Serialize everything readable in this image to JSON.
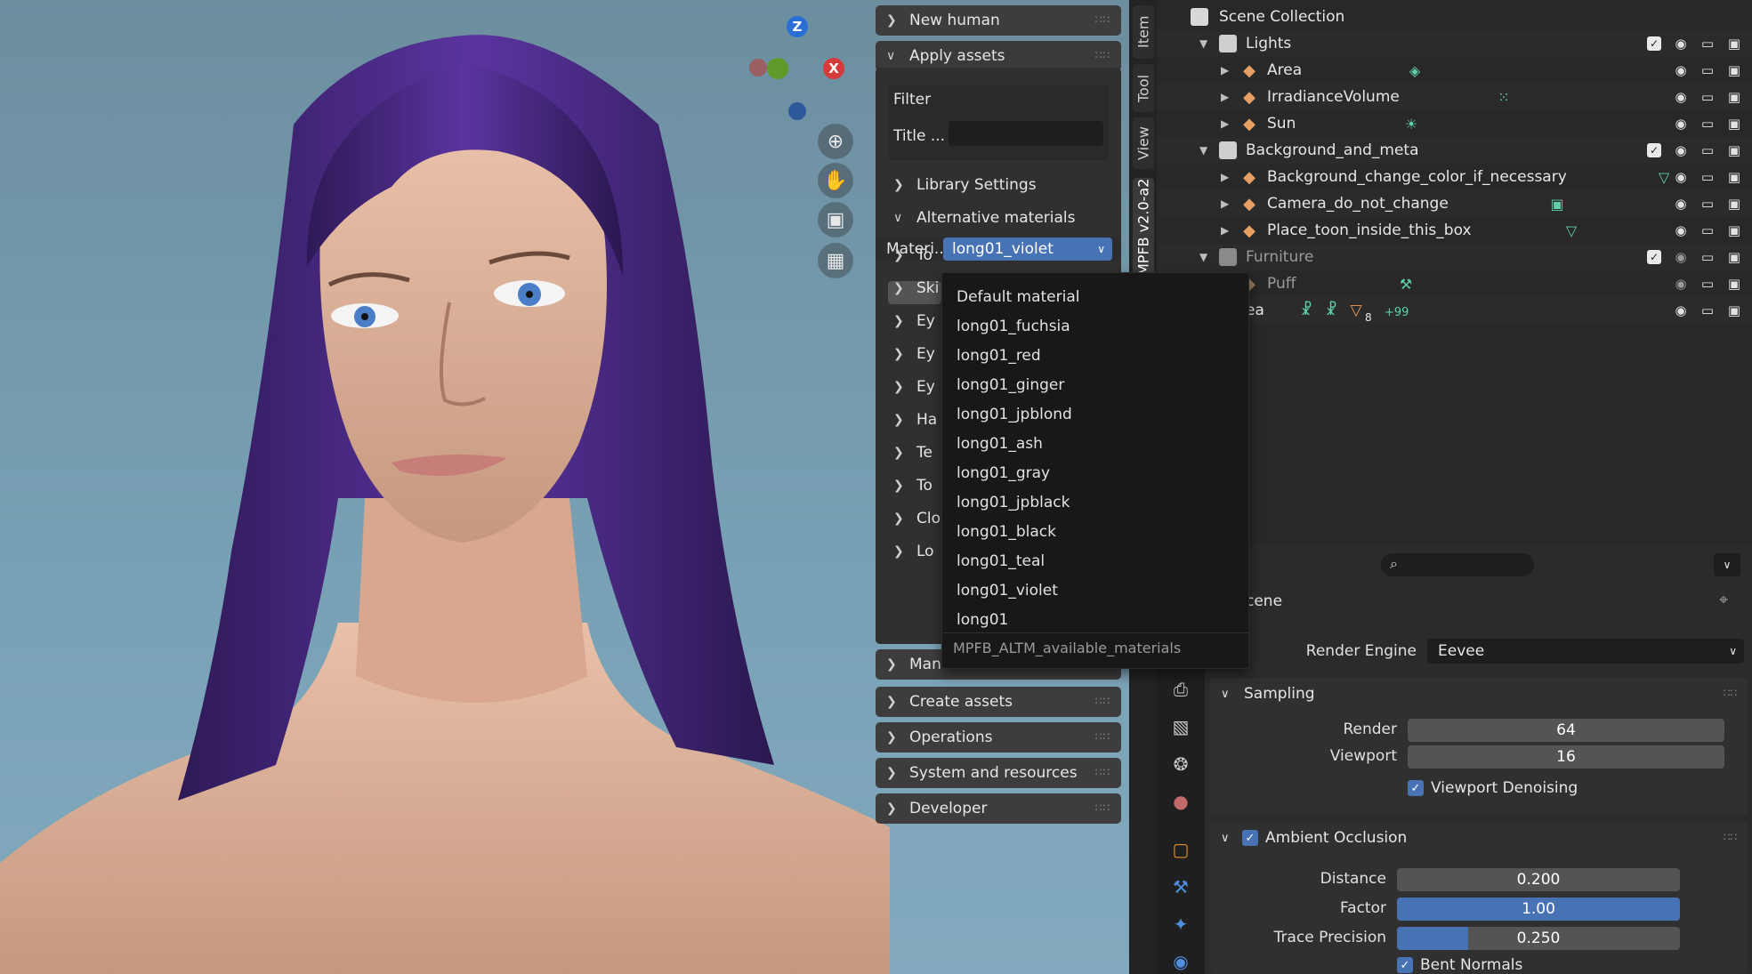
{
  "colors": {
    "accent": "#4772b3",
    "dropdown_bg": "#181818",
    "panel_bg": "#303030",
    "hair": "#4a2a86"
  },
  "viewport": {
    "gizmo": {
      "z": "Z",
      "x": "X",
      "y": "Y"
    },
    "tools": [
      "zoom-icon",
      "hand-icon",
      "camera-icon",
      "grid-icon"
    ]
  },
  "npanel": {
    "new_human": "New human",
    "apply_assets": "Apply assets",
    "filter": "Filter",
    "title_label": "Title ...",
    "title_value": "",
    "library_settings": "Library Settings",
    "alternative_materials": "Alternative materials",
    "material_label": "Materi...",
    "material_value": "long01_violet",
    "sub_items": [
      "To",
      "Ski",
      "Ey",
      "Ey",
      "Ey",
      "Ha",
      "Te",
      "To",
      "Clo",
      "Lo"
    ],
    "manage": "Mana",
    "create_assets": "Create assets",
    "operations": "Operations",
    "system_resources": "System and resources",
    "developer": "Developer"
  },
  "sidebar_tabs": [
    "Item",
    "Tool",
    "View",
    "MPFB v2.0-a2"
  ],
  "dropdown": {
    "items": [
      "Default material",
      "long01_fuchsia",
      "long01_red",
      "long01_ginger",
      "long01_jpblond",
      "long01_ash",
      "long01_gray",
      "long01_jpblack",
      "long01_black",
      "long01_teal",
      "long01_violet",
      "long01"
    ],
    "footer": "MPFB_ALTM_available_materials"
  },
  "outliner": {
    "scene_collection": "Scene Collection",
    "rows": [
      {
        "label": "Lights",
        "kind": "collection"
      },
      {
        "label": "Area",
        "kind": "light"
      },
      {
        "label": "IrradianceVolume",
        "kind": "probe"
      },
      {
        "label": "Sun",
        "kind": "light"
      },
      {
        "label": "Background_and_meta",
        "kind": "collection"
      },
      {
        "label": "Background_change_color_if_necessary",
        "kind": "mesh"
      },
      {
        "label": "Camera_do_not_change",
        "kind": "camera"
      },
      {
        "label": "Place_toon_inside_this_box",
        "kind": "mesh"
      },
      {
        "label": "Furniture",
        "kind": "collection"
      },
      {
        "label": "Puff",
        "kind": "mesh"
      },
      {
        "label": "ea",
        "kind": "armature"
      }
    ],
    "badge_count": "8",
    "badge_more": "+99"
  },
  "properties": {
    "scene_label": "cene",
    "render_engine_label": "Render Engine",
    "render_engine_value": "Eevee",
    "sampling": "Sampling",
    "render_label": "Render",
    "render_value": "64",
    "viewport_label": "Viewport",
    "viewport_value": "16",
    "viewport_denoising": "Viewport Denoising",
    "ambient_occlusion": "Ambient Occlusion",
    "distance_label": "Distance",
    "distance_value": "0.200",
    "factor_label": "Factor",
    "factor_value": "1.00",
    "factor_fraction": 1.0,
    "trace_label": "Trace Precision",
    "trace_value": "0.250",
    "trace_fraction": 0.25,
    "bent_normals": "Bent Normals"
  }
}
